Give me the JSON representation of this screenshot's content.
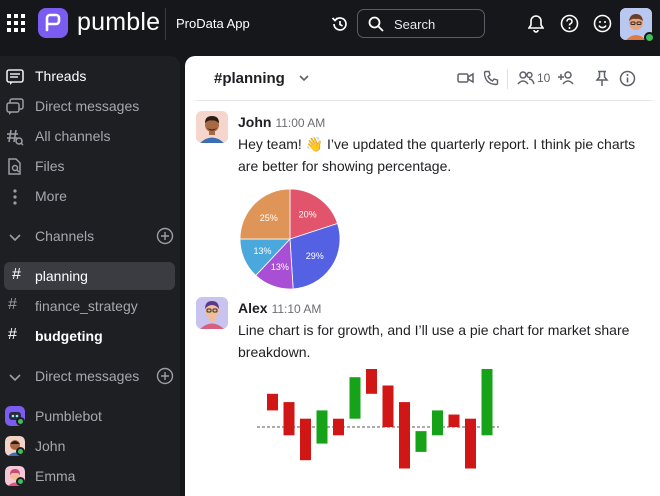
{
  "topbar": {
    "brand": "pumble",
    "workspace": "ProData App",
    "search_placeholder": "Search"
  },
  "sidebar": {
    "items": [
      {
        "label": "Threads",
        "icon": "threads-icon"
      },
      {
        "label": "Direct messages",
        "icon": "direct-messages-icon"
      },
      {
        "label": "All channels",
        "icon": "all-channels-icon"
      },
      {
        "label": "Files",
        "icon": "files-icon"
      },
      {
        "label": "More",
        "icon": "more-icon"
      }
    ],
    "channels_section": "Channels",
    "channels": [
      {
        "name": "planning"
      },
      {
        "name": "finance_strategy"
      },
      {
        "name": "budgeting"
      }
    ],
    "dm_section": "Direct messages",
    "dms": [
      {
        "name": "Pumblebot"
      },
      {
        "name": "John"
      },
      {
        "name": "Emma"
      }
    ]
  },
  "channel": {
    "name": "planning",
    "member_count": "10"
  },
  "messages": [
    {
      "author": "John",
      "time": "11:00 AM",
      "text": "Hey team! 👋 I’ve updated the quarterly report. I think pie charts are better for showing percentage."
    },
    {
      "author": "Alex",
      "time": "11:10 AM",
      "text": "Line chart is for growth, and I’ll use a pie chart for market share breakdown."
    }
  ],
  "chart_data": [
    {
      "type": "pie",
      "slices": [
        {
          "label": "20%",
          "value": 20,
          "color": "#e2546b"
        },
        {
          "label": "29%",
          "value": 29,
          "color": "#5561e3"
        },
        {
          "label": "13%",
          "value": 13,
          "color": "#a94fd6"
        },
        {
          "label": "13%",
          "value": 13,
          "color": "#4aa8dc"
        },
        {
          "label": "25%",
          "value": 25,
          "color": "#e09558"
        }
      ]
    },
    {
      "type": "candlestick",
      "reference_line": 0,
      "candles": [
        {
          "open": 4,
          "close": 2,
          "color": "#d11616"
        },
        {
          "open": 3,
          "close": -1,
          "color": "#d11616"
        },
        {
          "open": 1,
          "close": -4,
          "color": "#d11616"
        },
        {
          "open": -2,
          "close": 2,
          "color": "#16a31a"
        },
        {
          "open": 1,
          "close": -1,
          "color": "#d11616"
        },
        {
          "open": 1,
          "close": 6,
          "color": "#16a31a"
        },
        {
          "open": 7,
          "close": 4,
          "color": "#d11616"
        },
        {
          "open": 5,
          "close": 0,
          "color": "#d11616"
        },
        {
          "open": 3,
          "close": -5,
          "color": "#d11616"
        },
        {
          "open": -3,
          "close": -0.5,
          "color": "#16a31a"
        },
        {
          "open": -1,
          "close": 2,
          "color": "#16a31a"
        },
        {
          "open": 1.5,
          "close": 0,
          "color": "#d11616"
        },
        {
          "open": 1,
          "close": -5,
          "color": "#d11616"
        },
        {
          "open": -1,
          "close": 7,
          "color": "#16a31a"
        }
      ]
    }
  ]
}
